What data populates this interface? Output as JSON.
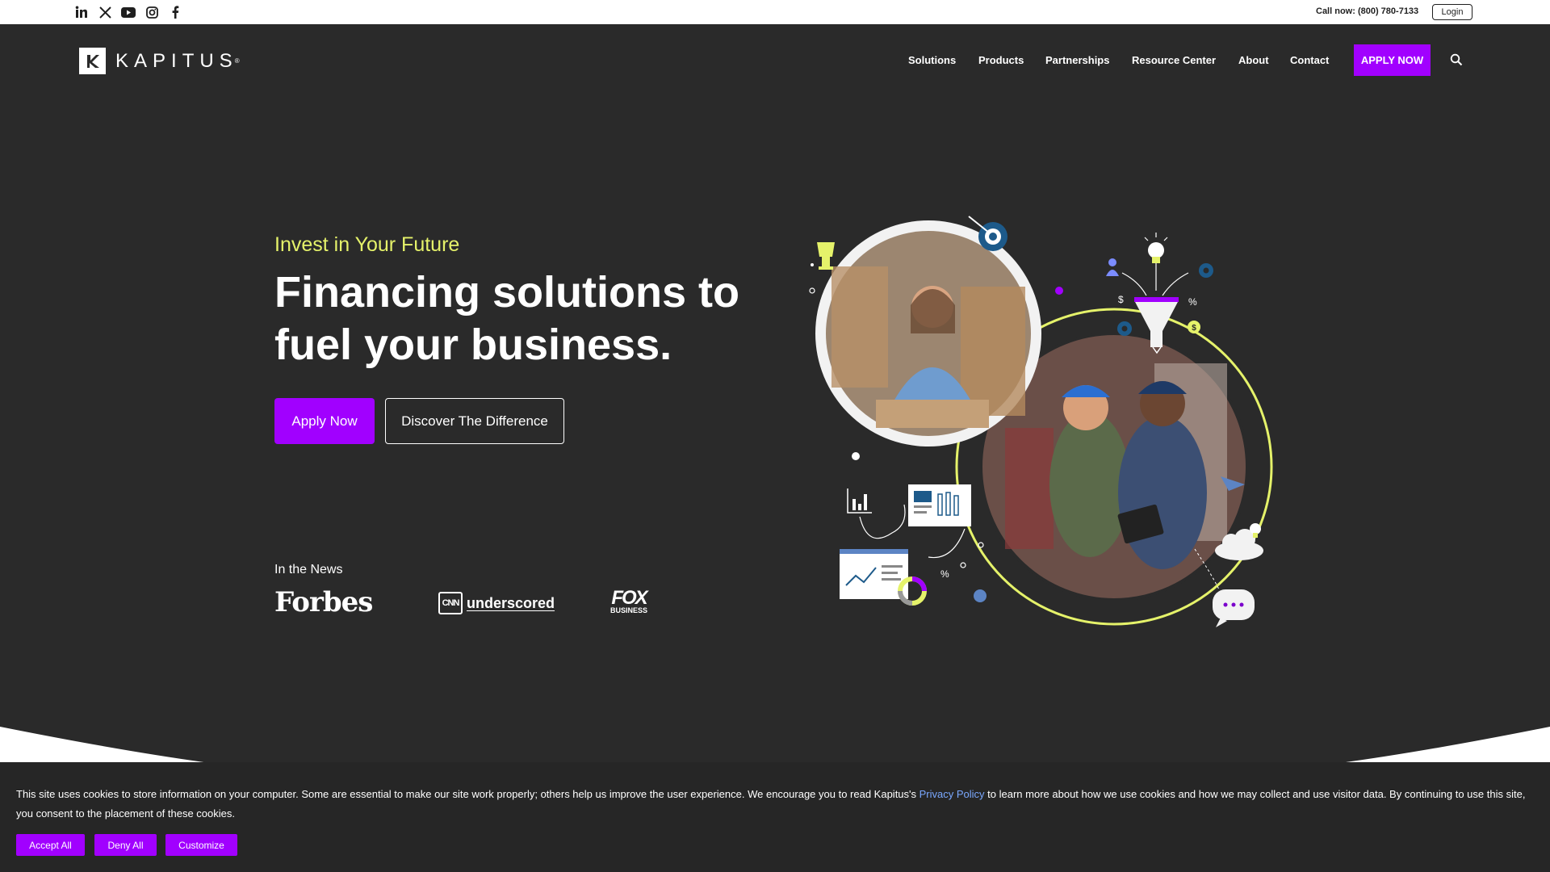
{
  "topbar": {
    "social": [
      "linkedin-icon",
      "x-icon",
      "youtube-icon",
      "instagram-icon",
      "facebook-icon"
    ],
    "call_text": "Call now: (800) 780-7133",
    "login_label": "Login"
  },
  "header": {
    "logo_text": "KAPITUS",
    "nav": [
      "Solutions",
      "Products",
      "Partnerships",
      "Resource Center",
      "About",
      "Contact"
    ],
    "apply_label": "APPLY NOW",
    "search_icon": "search-icon"
  },
  "hero": {
    "eyebrow": "Invest in Your Future",
    "headline": "Financing solutions to fuel your business.",
    "apply_label": "Apply Now",
    "discover_label": "Discover The Difference",
    "news_label": "In the News",
    "press": {
      "forbes": "Forbes",
      "cnn_badge": "CNN",
      "cnn_text": "underscored",
      "fox_main": "FOX",
      "fox_sub": "BUSINESS"
    }
  },
  "cookie": {
    "text_before": "This site uses cookies to store information on your computer. Some are essential to make our site work properly; others help us improve the user experience. We encourage you to read Kapitus's ",
    "link_text": "Privacy Policy",
    "text_after": " to learn more about how we use cookies and how we may collect and use visitor data. By continuing to use this site, you consent to the placement of these cookies.",
    "buttons": [
      "Accept All",
      "Deny All",
      "Customize"
    ]
  },
  "colors": {
    "background": "#2a2a2a",
    "accent": "#a100ff",
    "eyebrow": "#e5f26a",
    "link": "#7aa8ff"
  }
}
